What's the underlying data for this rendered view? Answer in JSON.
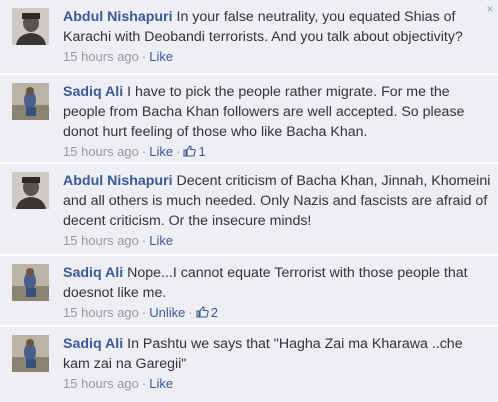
{
  "comments": [
    {
      "author": "Abdul Nishapuri",
      "text": "In your false neutrality, you equated Shias of Karachi with Deobandi terrorists. And you talk about objectivity?",
      "time": "15 hours ago",
      "action": "Like",
      "like_count": "",
      "avatar": "abdul-avatar"
    },
    {
      "author": "Sadiq Ali",
      "text": "I have to pick the people rather migrate. For me the people from Bacha Khan followers are well accepted. So please donot hurt feeling of those who like Bacha Khan.",
      "time": "15 hours ago",
      "action": "Like",
      "like_count": "1",
      "avatar": "sadiq-avatar"
    },
    {
      "author": "Abdul Nishapuri",
      "text": "Decent criticism of Bacha Khan, Jinnah, Khomeini and all others is much needed. Only Nazis and fascists are afraid of decent criticism. Or the insecure minds!",
      "time": "15 hours ago",
      "action": "Like",
      "like_count": "",
      "avatar": "abdul-avatar"
    },
    {
      "author": "Sadiq Ali",
      "text": "Nope...I cannot equate Terrorist with those people that doesnot like me.",
      "time": "15 hours ago",
      "action": "Unlike",
      "like_count": "2",
      "avatar": "sadiq-avatar"
    },
    {
      "author": "Sadiq Ali",
      "text": "In Pashtu we says that \"Hagha Zai ma Kharawa ..che kam zai na Garegii\"",
      "time": "15 hours ago",
      "action": "Like",
      "like_count": "",
      "avatar": "sadiq-avatar"
    }
  ],
  "separator": "·",
  "close_glyph": "×",
  "colors": {
    "link": "#3b5998",
    "text": "#333333",
    "meta": "#999999",
    "bg": "#edeff4"
  }
}
